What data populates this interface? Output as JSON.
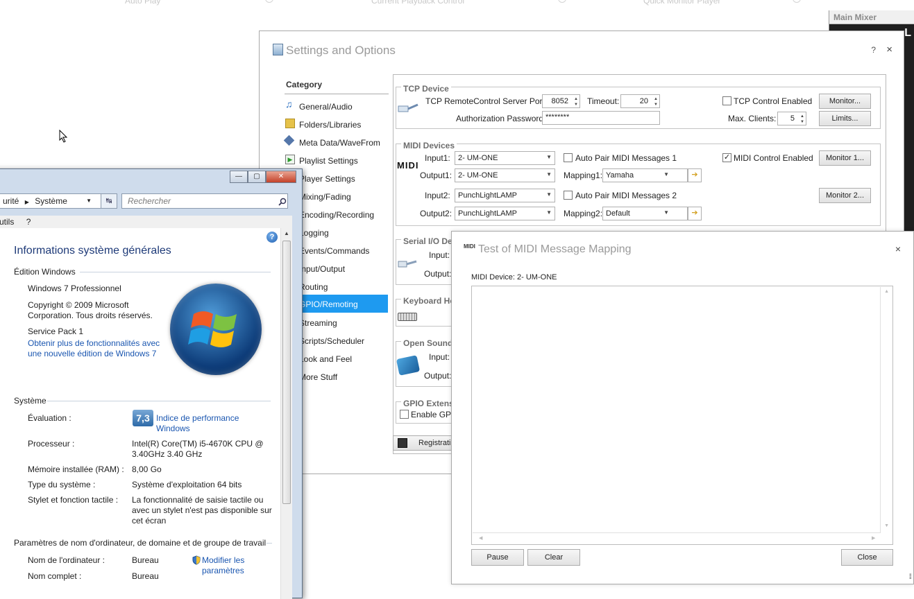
{
  "background": {
    "tabs": [
      "Auto Play",
      "Current Playback Control",
      "Quick Monitor Player"
    ],
    "mixer_title": "Main Mixer",
    "mixer_letter": "L"
  },
  "settings": {
    "title": "Settings and Options",
    "help": "?",
    "close": "×",
    "category_head": "Category",
    "categories": [
      {
        "label": "General/Audio",
        "icon": "music-note-icon"
      },
      {
        "label": "Folders/Libraries",
        "icon": "folder-icon"
      },
      {
        "label": "Meta Data/WaveFrom",
        "icon": "tag-icon"
      },
      {
        "label": "Playlist Settings",
        "icon": "play-icon"
      },
      {
        "label": "Player Settings",
        "icon": "player-icon"
      },
      {
        "label": "Mixing/Fading",
        "icon": "mixer-icon"
      },
      {
        "label": "Encoding/Recording",
        "icon": "record-icon"
      },
      {
        "label": "Logging",
        "icon": "log-icon"
      },
      {
        "label": "Events/Commands",
        "icon": "event-icon"
      },
      {
        "label": "Input/Output",
        "icon": "io-icon"
      },
      {
        "label": "Routing",
        "icon": "routing-icon"
      },
      {
        "label": "GPIO/Remoting",
        "icon": "gpio-icon"
      },
      {
        "label": "Streaming",
        "icon": "stream-icon"
      },
      {
        "label": "Scripts/Scheduler",
        "icon": "script-icon"
      },
      {
        "label": "Look and Feel",
        "icon": "palette-icon"
      },
      {
        "label": "More Stuff",
        "icon": "more-icon"
      }
    ],
    "tcp": {
      "title": "TCP Device",
      "port_label": "TCP RemoteControl Server Port:",
      "port": "8052",
      "timeout_label": "Timeout:",
      "timeout": "20",
      "enabled_label": "TCP Control Enabled",
      "password_label": "Authorization Password:",
      "password": "********",
      "max_clients_label": "Max. Clients:",
      "max_clients": "5",
      "monitor_btn": "Monitor...",
      "limits_btn": "Limits..."
    },
    "midi": {
      "title": "MIDI Devices",
      "logo": "MIDI",
      "input1_label": "Input1:",
      "input1": "2- UM-ONE",
      "output1_label": "Output1:",
      "output1": "2- UM-ONE",
      "input2_label": "Input2:",
      "input2": "PunchLightLAMP",
      "output2_label": "Output2:",
      "output2": "PunchLightLAMP",
      "autopair1": "Auto Pair MIDI Messages 1",
      "autopair2": "Auto Pair MIDI Messages 2",
      "mapping1_label": "Mapping1:",
      "mapping1": "Yamaha",
      "mapping2_label": "Mapping2:",
      "mapping2": "Default",
      "enabled_label": "MIDI Control Enabled",
      "monitor1_btn": "Monitor 1...",
      "monitor2_btn": "Monitor 2..."
    },
    "serial": {
      "title": "Serial I/O De",
      "input_label": "Input:",
      "output_label": "Output:"
    },
    "keyboard": {
      "title": "Keyboard Ho"
    },
    "osc": {
      "title": "Open Sound",
      "input_label": "Input:",
      "output_label": "Output:"
    },
    "gpio": {
      "title": "GPIO Extens",
      "enable_label": "Enable GPIO"
    },
    "registration": "Registrati"
  },
  "win7": {
    "address_prefix": "urité",
    "address": "Système",
    "search_placeholder": "Rechercher",
    "menu": [
      "utils",
      "?"
    ],
    "heading": "Informations système générales",
    "edition_section": "Édition Windows",
    "edition": "Windows 7 Professionnel",
    "copyright_1": "Copyright © 2009 Microsoft",
    "copyright_2": "Corporation. Tous droits réservés.",
    "service_pack": "Service Pack 1",
    "upgrade_link_1": "Obtenir plus de fonctionnalités avec",
    "upgrade_link_2": "une nouvelle édition de Windows 7",
    "system_section": "Système",
    "rating_label": "Évaluation :",
    "rating_value": "7,3",
    "rating_link_1": "Indice de performance",
    "rating_link_2": "Windows",
    "processor_label": "Processeur :",
    "processor_1": "Intel(R) Core(TM) i5-4670K CPU @",
    "processor_2": "3.40GHz   3.40 GHz",
    "ram_label": "Mémoire installée (RAM) :",
    "ram": "8,00 Go",
    "type_label": "Type du système :",
    "type": "Système d'exploitation 64 bits",
    "pen_label": "Stylet et fonction tactile :",
    "pen_1": "La fonctionnalité de saisie tactile ou",
    "pen_2": "avec un stylet n'est pas disponible sur",
    "pen_3": "cet écran",
    "computer_section": "Paramètres de nom d'ordinateur, de domaine et de groupe de travail",
    "computer_name_label": "Nom de l'ordinateur :",
    "computer_name": "Bureau",
    "full_name_label": "Nom complet :",
    "full_name": "Bureau",
    "modify_link_1": "Modifier les",
    "modify_link_2": "paramètres"
  },
  "miditest": {
    "title": "Test of MIDI Message Mapping",
    "icon": "MIDI",
    "close": "×",
    "device_label": "MIDI Device:",
    "device": "2- UM-ONE",
    "pause": "Pause",
    "clear": "Clear",
    "close_btn": "Close"
  }
}
